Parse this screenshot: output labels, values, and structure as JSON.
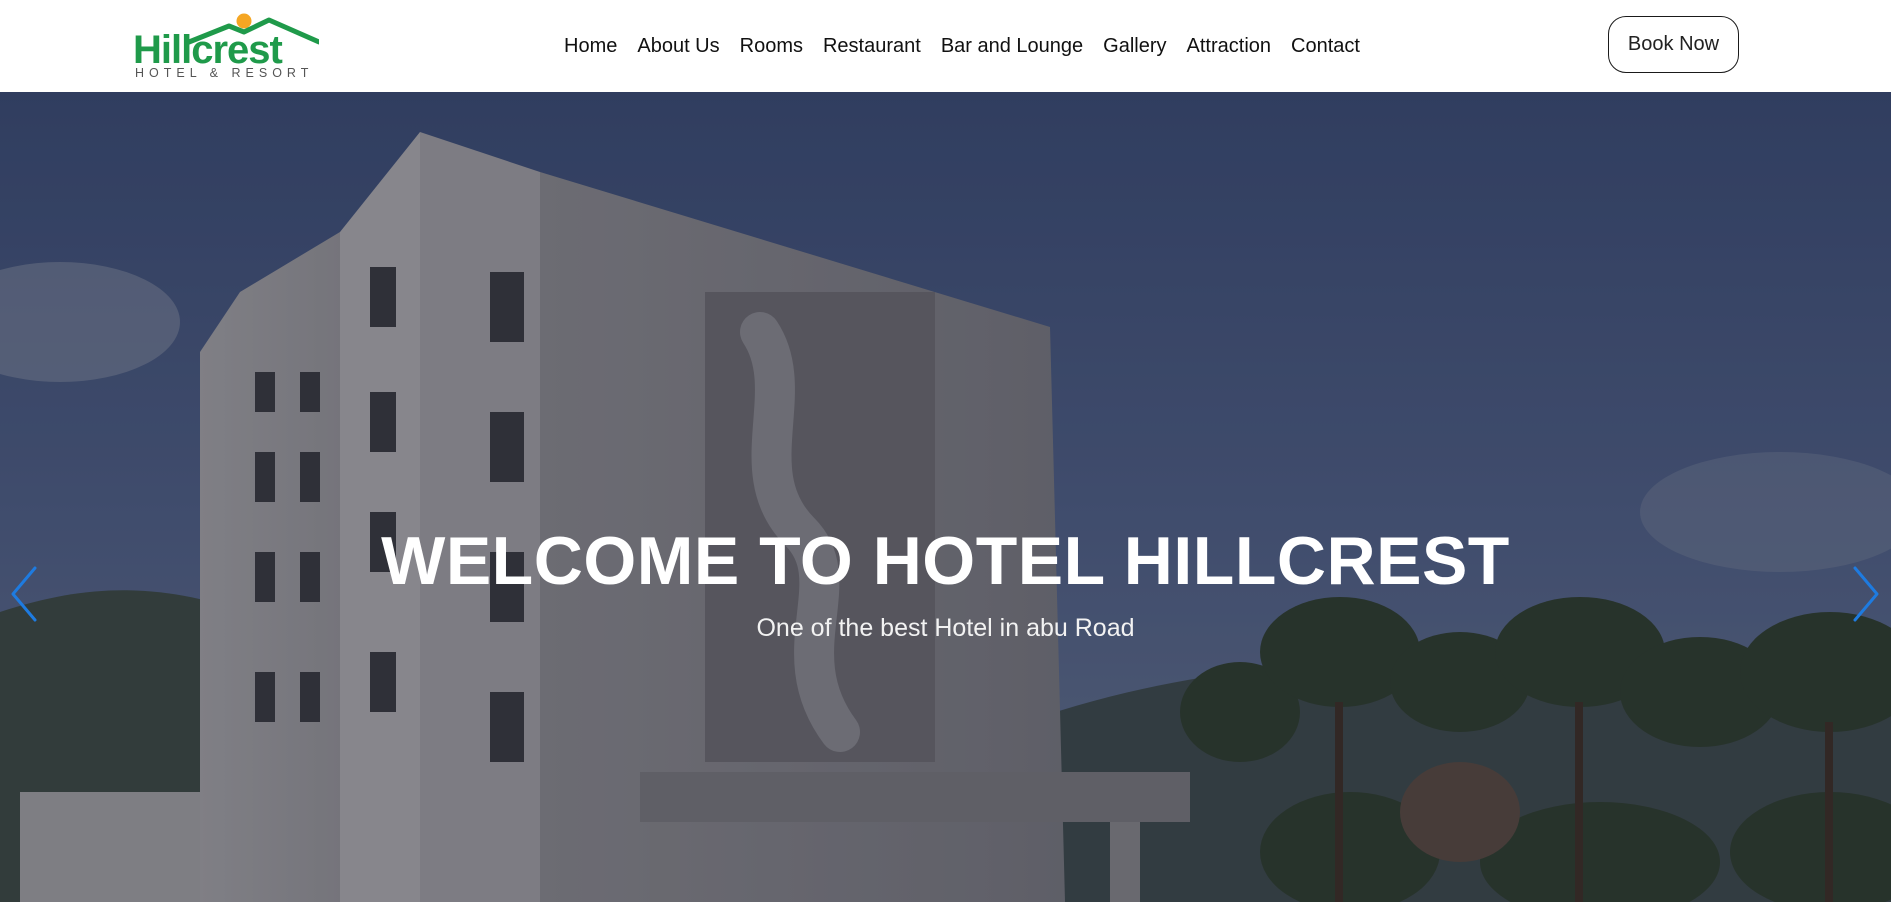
{
  "header": {
    "logo": {
      "brand": "Hillcrest",
      "tagline": "HOTEL & RESORT"
    },
    "nav": [
      {
        "label": "Home"
      },
      {
        "label": "About Us"
      },
      {
        "label": "Rooms"
      },
      {
        "label": "Restaurant"
      },
      {
        "label": "Bar and Lounge"
      },
      {
        "label": "Gallery"
      },
      {
        "label": "Attraction"
      },
      {
        "label": "Contact"
      }
    ],
    "book_button": "Book Now"
  },
  "hero": {
    "title": "WELCOME TO HOTEL HILLCREST",
    "subtitle": "One of the best Hotel in abu Road",
    "prev_icon": "chevron-left-icon",
    "next_icon": "chevron-right-icon"
  },
  "colors": {
    "brand_green": "#1f9a4a",
    "sun_orange": "#f5a623",
    "arrow_blue": "#1e7be0",
    "text_dark": "#111111"
  }
}
